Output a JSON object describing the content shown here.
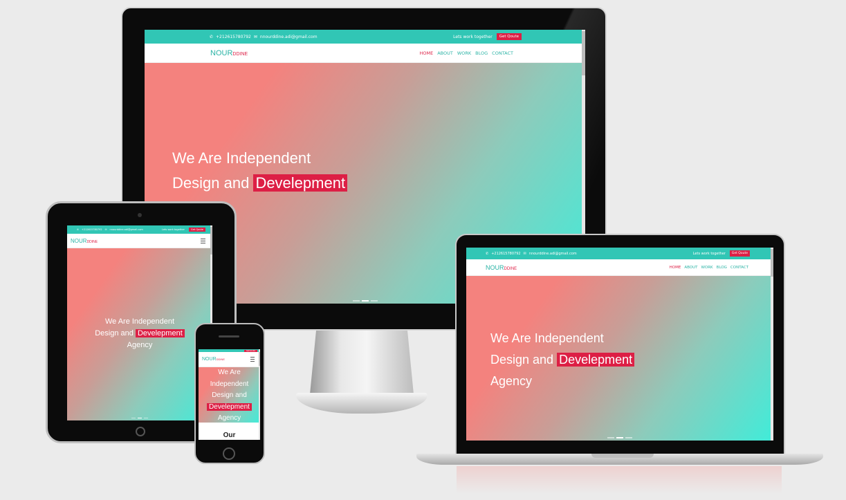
{
  "site": {
    "phone": "+212615780792",
    "email": "nnourddine.adi@gmail.com",
    "lets_work": "Lets work together",
    "quote_button": "Get Qoute",
    "logo_main": "NOUR",
    "logo_small": "DDINE",
    "menu": [
      "HOME",
      "ABOUT",
      "WORK",
      "BLOG",
      "CONTACT"
    ],
    "headline_line1": "We Are Independent",
    "headline_line2_prefix": "Design and",
    "headline_highlight": "Develepment",
    "headline_line3": "Agency",
    "next_section_title": "Our"
  },
  "colors": {
    "teal": "#31c6b5",
    "accent_red": "#dd1f45",
    "gradient_start": "#f4827e",
    "gradient_end": "#40ecd9"
  },
  "icons": {
    "phone": "phone-icon",
    "email": "envelope-icon",
    "menu": "hamburger-icon"
  }
}
